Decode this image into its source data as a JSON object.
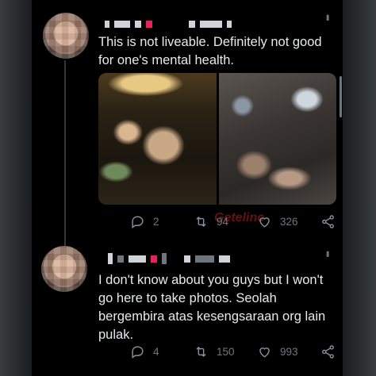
{
  "tweets": [
    {
      "text": "This is not liveable. Definitely not good for one's mental health.",
      "actions": {
        "replies": "2",
        "retweets": "94",
        "likes": "326"
      }
    },
    {
      "text": "I don't know about you guys but I won't go here to take photos. Seolah bergembira atas kesengsaraan org lain pulak.",
      "actions": {
        "replies": "4",
        "retweets": "150",
        "likes": "993"
      }
    }
  ],
  "watermark": "Getelinc",
  "icons": [
    "reply-icon",
    "retweet-icon",
    "like-icon",
    "share-icon",
    "more-icon"
  ],
  "colors": {
    "background": "#000000",
    "text": "#e7e9ea",
    "muted": "#71767b",
    "accent_red": "#e0245e"
  }
}
